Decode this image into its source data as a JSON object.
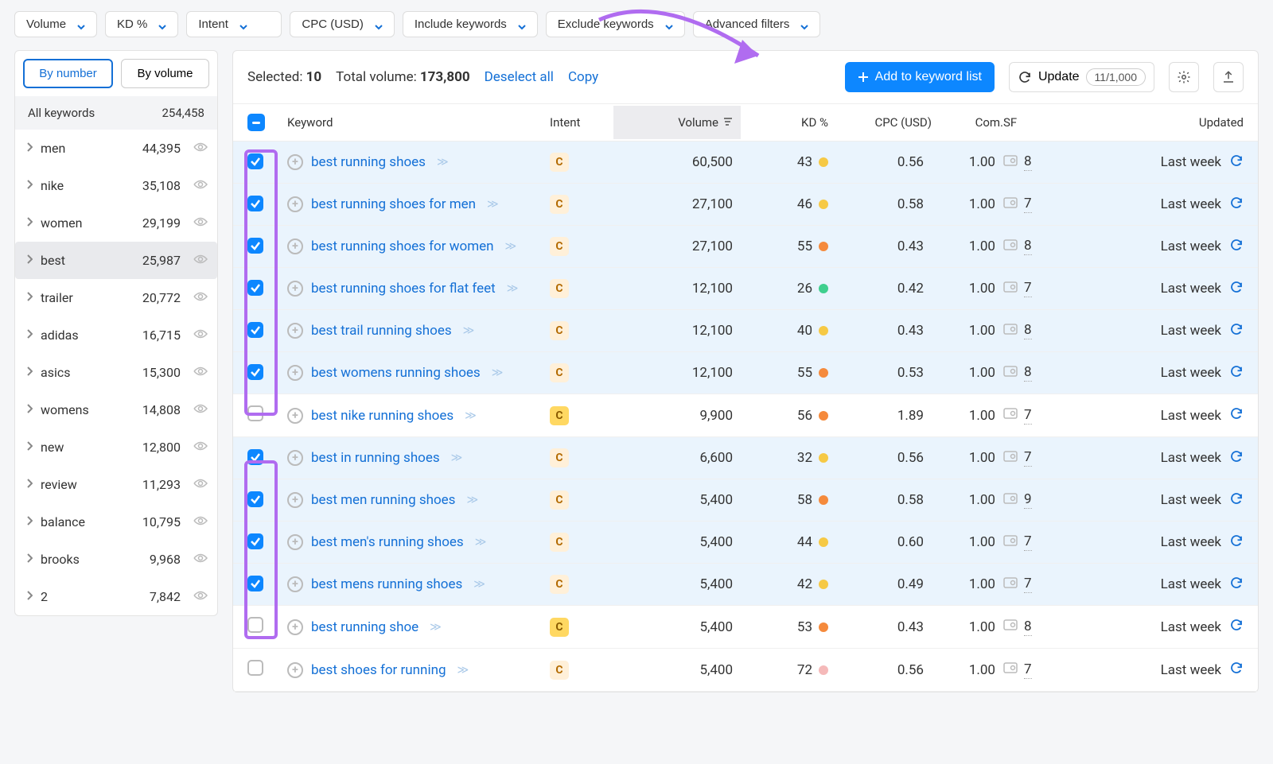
{
  "filters": {
    "volume": "Volume",
    "kd": "KD %",
    "intent": "Intent",
    "cpc": "CPC (USD)",
    "include": "Include keywords",
    "exclude": "Exclude keywords",
    "advanced": "Advanced filters"
  },
  "sidebar": {
    "tab_by_number": "By number",
    "tab_by_volume": "By volume",
    "all_label": "All keywords",
    "all_count": "254,458",
    "items": [
      {
        "label": "men",
        "count": "44,395"
      },
      {
        "label": "nike",
        "count": "35,108"
      },
      {
        "label": "women",
        "count": "29,199"
      },
      {
        "label": "best",
        "count": "25,987"
      },
      {
        "label": "trailer",
        "count": "20,772"
      },
      {
        "label": "adidas",
        "count": "16,715"
      },
      {
        "label": "asics",
        "count": "15,300"
      },
      {
        "label": "womens",
        "count": "14,808"
      },
      {
        "label": "new",
        "count": "12,800"
      },
      {
        "label": "review",
        "count": "11,293"
      },
      {
        "label": "balance",
        "count": "10,795"
      },
      {
        "label": "brooks",
        "count": "9,968"
      },
      {
        "label": "2",
        "count": "7,842"
      }
    ]
  },
  "topbar": {
    "selected_label": "Selected:",
    "selected_value": "10",
    "total_label": "Total volume:",
    "total_value": "173,800",
    "deselect": "Deselect all",
    "copy": "Copy",
    "add": "Add to keyword list",
    "update": "Update",
    "update_count": "11/1,000"
  },
  "columns": {
    "keyword": "Keyword",
    "intent": "Intent",
    "volume": "Volume",
    "kd": "KD %",
    "cpc": "CPC (USD)",
    "com": "Com.",
    "sf": "SF",
    "updated": "Updated"
  },
  "rows": [
    {
      "checked": true,
      "keyword": "best running shoes",
      "intent_class": "intent-c",
      "volume": "60,500",
      "kd": "43",
      "kd_dot": "d-yellow",
      "cpc": "0.56",
      "com": "1.00",
      "sf": "8",
      "updated": "Last week"
    },
    {
      "checked": true,
      "keyword": "best running shoes for men",
      "intent_class": "intent-c",
      "volume": "27,100",
      "kd": "46",
      "kd_dot": "d-yellow",
      "cpc": "0.58",
      "com": "1.00",
      "sf": "7",
      "updated": "Last week"
    },
    {
      "checked": true,
      "keyword": "best running shoes for women",
      "intent_class": "intent-c",
      "volume": "27,100",
      "kd": "55",
      "kd_dot": "d-orange",
      "cpc": "0.43",
      "com": "1.00",
      "sf": "8",
      "updated": "Last week"
    },
    {
      "checked": true,
      "keyword": "best running shoes for flat feet",
      "intent_class": "intent-c",
      "volume": "12,100",
      "kd": "26",
      "kd_dot": "d-green",
      "cpc": "0.42",
      "com": "1.00",
      "sf": "7",
      "updated": "Last week"
    },
    {
      "checked": true,
      "keyword": "best trail running shoes",
      "intent_class": "intent-c",
      "volume": "12,100",
      "kd": "40",
      "kd_dot": "d-yellow",
      "cpc": "0.43",
      "com": "1.00",
      "sf": "8",
      "updated": "Last week"
    },
    {
      "checked": true,
      "keyword": "best womens running shoes",
      "intent_class": "intent-c",
      "volume": "12,100",
      "kd": "55",
      "kd_dot": "d-orange",
      "cpc": "0.53",
      "com": "1.00",
      "sf": "8",
      "updated": "Last week"
    },
    {
      "checked": false,
      "keyword": "best nike running shoes",
      "intent_class": "intent-c-bright",
      "volume": "9,900",
      "kd": "56",
      "kd_dot": "d-orange",
      "cpc": "1.89",
      "com": "1.00",
      "sf": "7",
      "updated": "Last week"
    },
    {
      "checked": true,
      "keyword": "best in running shoes",
      "intent_class": "intent-c",
      "volume": "6,600",
      "kd": "32",
      "kd_dot": "d-yellow",
      "cpc": "0.56",
      "com": "1.00",
      "sf": "7",
      "updated": "Last week"
    },
    {
      "checked": true,
      "keyword": "best men running shoes",
      "intent_class": "intent-c",
      "volume": "5,400",
      "kd": "58",
      "kd_dot": "d-orange",
      "cpc": "0.58",
      "com": "1.00",
      "sf": "9",
      "updated": "Last week"
    },
    {
      "checked": true,
      "keyword": "best men's running shoes",
      "intent_class": "intent-c",
      "volume": "5,400",
      "kd": "44",
      "kd_dot": "d-yellow",
      "cpc": "0.60",
      "com": "1.00",
      "sf": "7",
      "updated": "Last week"
    },
    {
      "checked": true,
      "keyword": "best mens running shoes",
      "intent_class": "intent-c",
      "volume": "5,400",
      "kd": "42",
      "kd_dot": "d-yellow",
      "cpc": "0.49",
      "com": "1.00",
      "sf": "7",
      "updated": "Last week"
    },
    {
      "checked": false,
      "keyword": "best running shoe",
      "intent_class": "intent-c-bright",
      "volume": "5,400",
      "kd": "53",
      "kd_dot": "d-orange",
      "cpc": "0.43",
      "com": "1.00",
      "sf": "8",
      "updated": "Last week"
    },
    {
      "checked": false,
      "keyword": "best shoes for running",
      "intent_class": "intent-c",
      "volume": "5,400",
      "kd": "72",
      "kd_dot": "d-pink",
      "cpc": "0.56",
      "com": "1.00",
      "sf": "7",
      "updated": "Last week"
    }
  ]
}
